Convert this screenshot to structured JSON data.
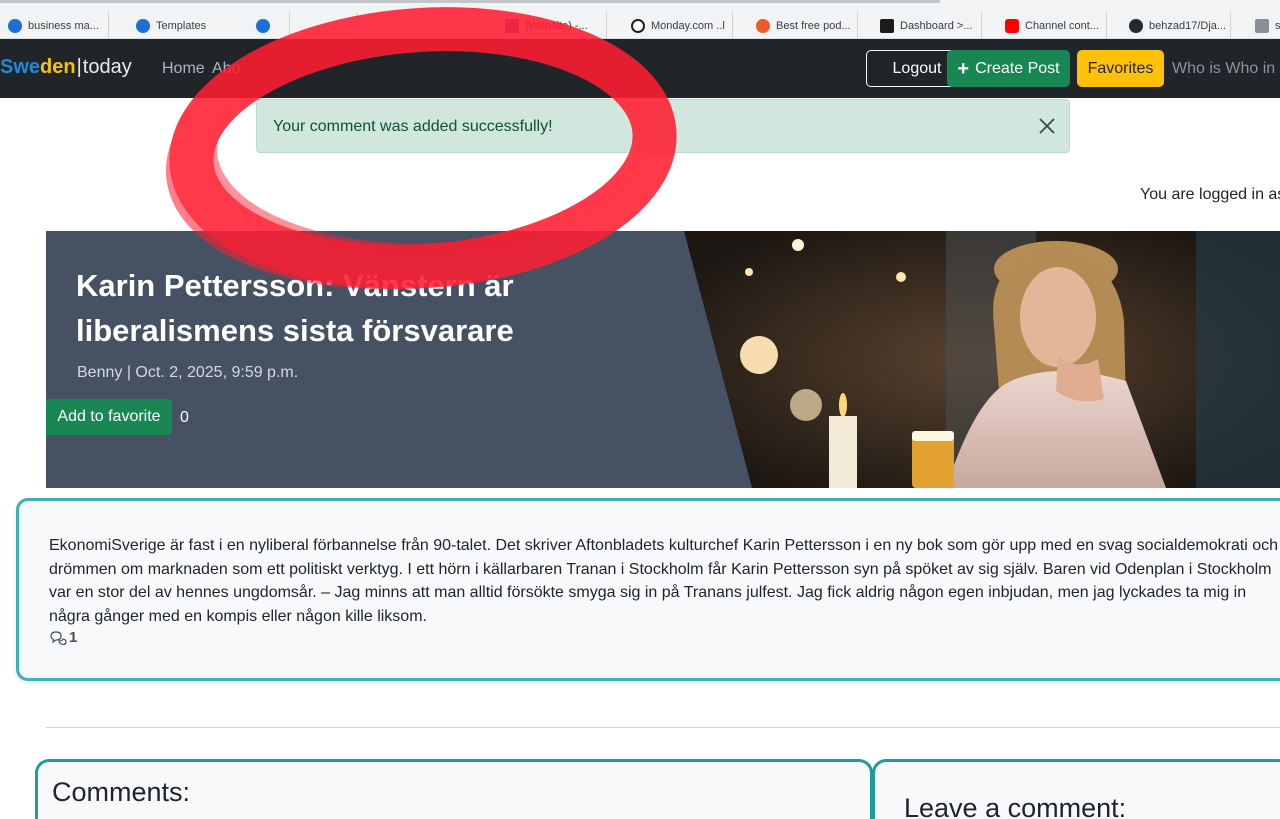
{
  "bookmarks": [
    {
      "label": "business ma...",
      "icon": "edge-icon",
      "color": "#1f6fd9"
    },
    {
      "label": "Templates",
      "icon": "edge-icon",
      "color": "#1f6fd9"
    },
    {
      "label": "",
      "icon": "edge-icon",
      "color": "#1f6fd9"
    },
    {
      "label": "(Website) -...",
      "icon": "site-icon",
      "color": "#7b5cd6"
    },
    {
      "label": "Monday.com ..l",
      "icon": "openai-icon",
      "color": "#202123"
    },
    {
      "label": "Best free pod...",
      "icon": "podcast-icon",
      "color": "#f05a28"
    },
    {
      "label": "Dashboard >...",
      "icon": "wifi-icon",
      "color": "#2e7d32"
    },
    {
      "label": "Channel cont...",
      "icon": "youtube-icon",
      "color": "#ff0000"
    },
    {
      "label": "behzad17/Dja...",
      "icon": "github-icon",
      "color": "#24292f"
    },
    {
      "label": "s",
      "icon": "h-icon",
      "color": "#8a8f98"
    }
  ],
  "navbar": {
    "brand": {
      "part1": "Swe",
      "part2": "den",
      "part3": "today"
    },
    "links": [
      "Home",
      "Abo"
    ],
    "logout": "Logout",
    "create_post": "Create Post",
    "favorites": "Favorites",
    "who": "Who is Who in S"
  },
  "alert": {
    "message": "Your comment was added successfully!"
  },
  "logged_in": "You are logged in as",
  "post": {
    "title": "Karin Pettersson: Vänstern är liberalismens sista försvarare",
    "meta": "Benny | Oct. 2, 2025, 9:59 p.m.",
    "favorite_button": "Add to favorite",
    "favorite_count": "0",
    "content": "EkonomiSverige är fast i en nyliberal förbannelse från 90-talet. Det skriver Aftonbladets kulturchef Karin Pettersson i en ny bok som gör upp med en svag socialdemokrati och drömmen om marknaden som ett politiskt verktyg. I ett hörn i källarbaren Tranan i Stockholm får Karin Pettersson syn på spöket av sig själv. Baren vid Odenplan i Stockholm var en stor del av hennes ungdomsår. – Jag minns att man alltid försökte smyga sig in på Tranans julfest. Jag fick aldrig någon egen inbjudan, men jag lyckades ta mig in några gånger med en kompis eller någon kille liksom.",
    "comment_count": "1"
  },
  "comments_heading": "Comments:",
  "leave_comment_heading": "Leave a comment:",
  "colors": {
    "navbar_bg": "#212529",
    "success": "#198754",
    "warning": "#ffc107",
    "alert_bg": "#d1e7dd",
    "card_border": "#3bb3b3",
    "hero_bg": "#465264",
    "red_marker": "#ff1e32"
  }
}
